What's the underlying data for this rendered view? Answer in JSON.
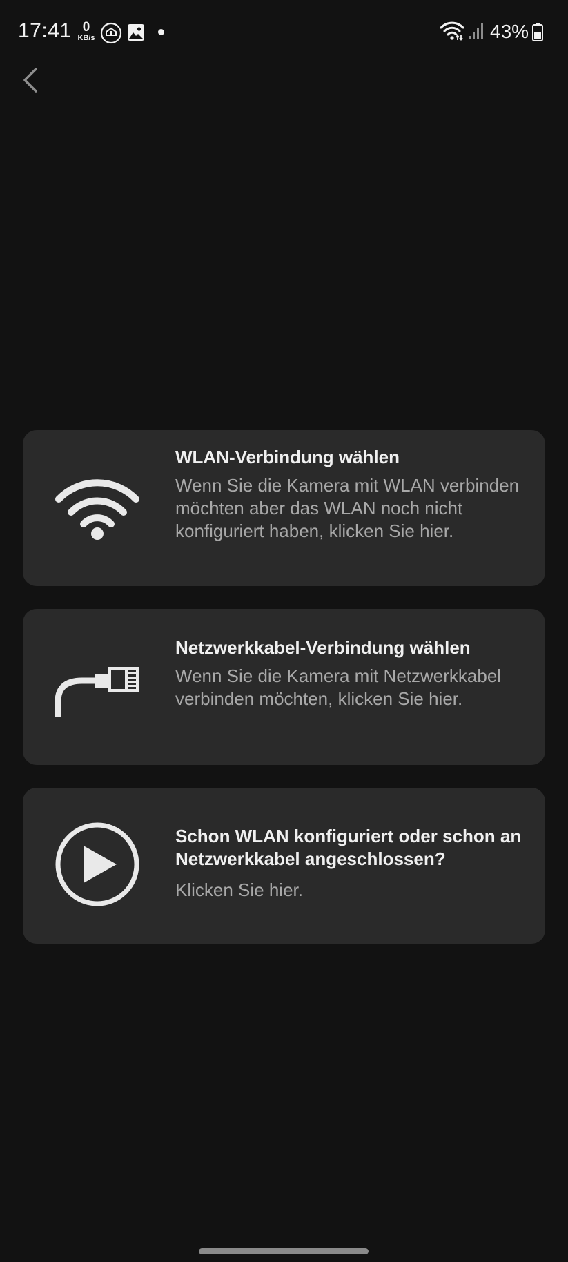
{
  "status_bar": {
    "time": "17:41",
    "net_speed_value": "0",
    "net_speed_unit": "KB/s",
    "battery": "43%",
    "icons": [
      "recording-icon",
      "gallery-icon",
      "notification-dot-icon",
      "wifi-icon",
      "signal-icon",
      "battery-icon"
    ]
  },
  "nav": {
    "back_icon": "chevron-left-icon"
  },
  "options": [
    {
      "icon": "wifi-icon",
      "title": "WLAN-Verbindung wählen",
      "description": "Wenn Sie die Kamera mit WLAN verbinden möchten aber das WLAN noch nicht konfiguriert haben, klicken Sie hier."
    },
    {
      "icon": "network-cable-icon",
      "title": "Netzwerkkabel-Verbindung wählen",
      "description": "Wenn Sie die Kamera mit Netzwerkkabel verbinden möchten, klicken Sie hier."
    },
    {
      "icon": "play-circle-icon",
      "title": "Schon WLAN konfiguriert oder schon an Netzwerkkabel angeschlossen?",
      "description": "Klicken Sie hier."
    }
  ],
  "colors": {
    "background": "#121212",
    "card": "#2a2a2a",
    "title_text": "#f0f0f0",
    "description_text": "#a8a8a8"
  }
}
